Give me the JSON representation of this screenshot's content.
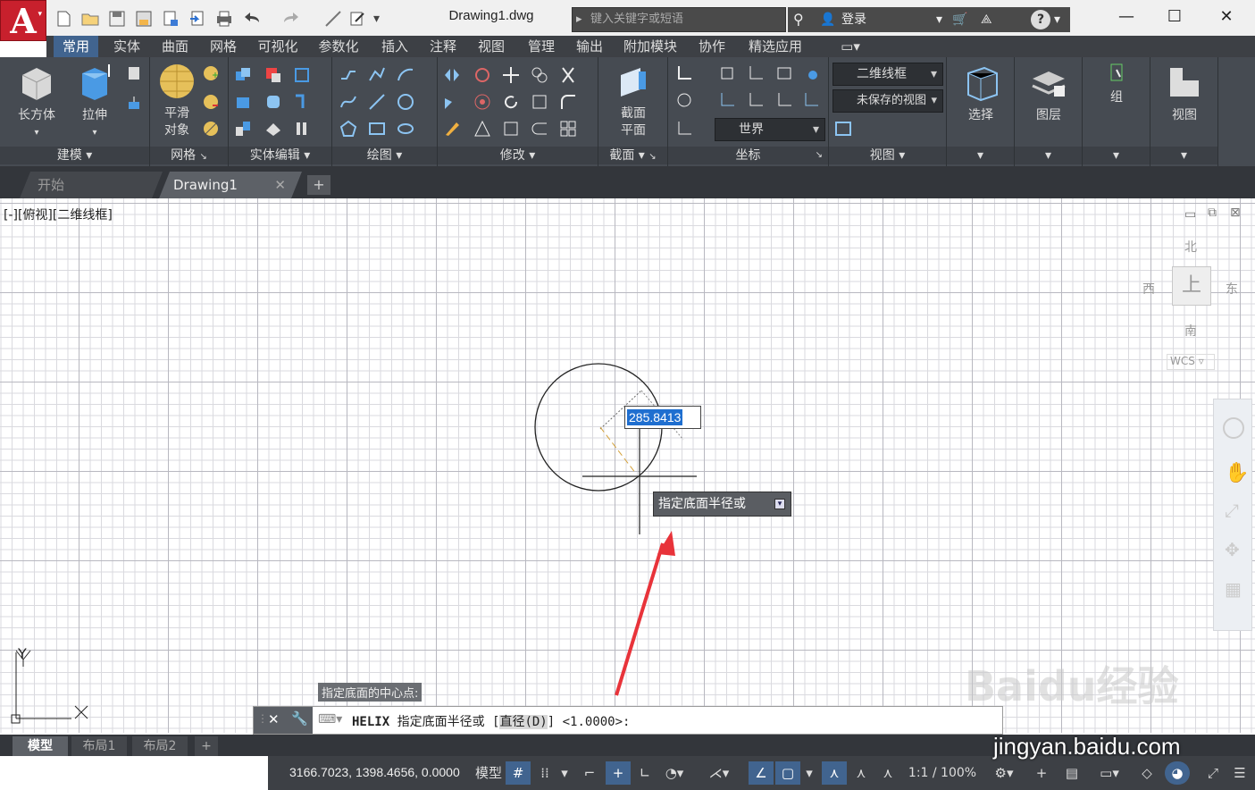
{
  "titlebar": {
    "document_title": "Drawing1.dwg",
    "search_placeholder": "键入关键字或短语",
    "login_label": "登录"
  },
  "ribbon_tabs": [
    "常用",
    "实体",
    "曲面",
    "网格",
    "可视化",
    "参数化",
    "插入",
    "注释",
    "视图",
    "管理",
    "输出",
    "附加模块",
    "协作",
    "精选应用"
  ],
  "active_tab": "常用",
  "ribbon": {
    "modeling": {
      "box_label": "长方体",
      "extrude_label": "拉伸",
      "panel_label": "建模"
    },
    "mesh": {
      "smooth_label_1": "平滑",
      "smooth_label_2": "对象",
      "panel_label": "网格"
    },
    "solid_edit": {
      "panel_label": "实体编辑"
    },
    "draw": {
      "panel_label": "绘图"
    },
    "modify": {
      "panel_label": "修改"
    },
    "section": {
      "plane_label_1": "截面",
      "plane_label_2": "平面",
      "panel_label": "截面"
    },
    "coordinates": {
      "world_label": "世界",
      "panel_label": "坐标"
    },
    "view": {
      "visual_style": "二维线框",
      "saved_view": "未保存的视图",
      "panel_label": "视图"
    },
    "select_label": "选择",
    "layers_label": "图层",
    "group_label": "组",
    "view_big_label": "视图"
  },
  "doc_tabs": {
    "start": "开始",
    "drawing": "Drawing1"
  },
  "viewport": {
    "label": "[-][俯视][二维线框]",
    "compass": {
      "north": "北",
      "south": "南",
      "west": "西",
      "east": "东",
      "top": "上"
    },
    "wcs": "WCS",
    "axis_y": "Y",
    "axis_x": "X"
  },
  "dynamic_input": {
    "value": "285.8413",
    "tooltip": "指定底面半径或",
    "previous_prompt": "指定底面的中心点:"
  },
  "command_line": {
    "command": "HELIX",
    "prompt": "指定底面半径或",
    "option": "直径(D)",
    "default": "<1.0000>:"
  },
  "layout_tabs": [
    "模型",
    "布局1",
    "布局2"
  ],
  "status": {
    "coordinates": "3166.7023, 1398.4656, 0.0000",
    "model_label": "模型",
    "scale": "1:1 / 100%"
  },
  "watermark": {
    "brand": "Baidu经验",
    "url": "jingyan.baidu.com"
  },
  "colors": {
    "accent": "#41648f",
    "ribbon_bg": "#464b52",
    "dim_highlight": "#1f6fd0",
    "arrow": "#e8333a"
  }
}
